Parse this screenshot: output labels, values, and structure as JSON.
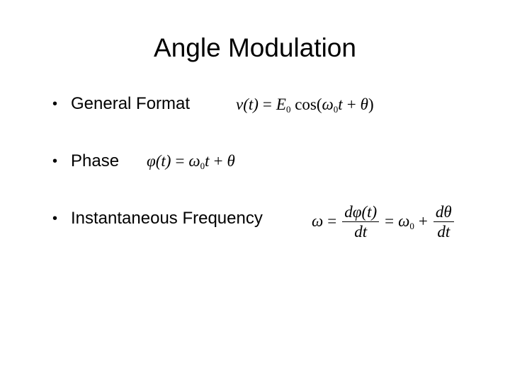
{
  "slide": {
    "title": "Angle Modulation",
    "bullets": [
      {
        "marker": "•",
        "label": "General Format",
        "formula": {
          "lhs": "v(t)",
          "eq": "=",
          "E": "E",
          "E_sub": "0",
          "fn": " cos(",
          "omega": "ω",
          "omega_sub": "0",
          "t": "t",
          "plus": "+",
          "theta": "θ",
          "close": ")"
        }
      },
      {
        "marker": "•",
        "label": "Phase",
        "formula": {
          "lhs": "φ(t)",
          "eq": "=",
          "omega": "ω",
          "omega_sub": "0",
          "t": "t",
          "plus": "+",
          "theta": "θ"
        }
      },
      {
        "marker": "•",
        "label": "Instantaneous Frequency",
        "formula": {
          "lhs": "ω",
          "eq1": "=",
          "frac1_num": "dφ(t)",
          "frac1_den": "dt",
          "eq2": "=",
          "omega": "ω",
          "omega_sub": "0",
          "plus": "+",
          "frac2_num": "dθ",
          "frac2_den": "dt"
        }
      }
    ]
  }
}
